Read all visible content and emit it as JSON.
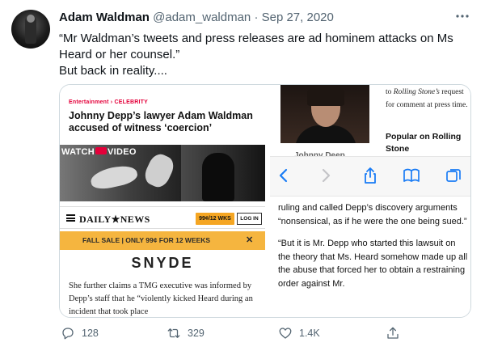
{
  "tweet": {
    "name": "Adam Waldman",
    "handle": "@adam_waldman",
    "separator": "·",
    "date": "Sep 27, 2020",
    "more_icon": "more-icon",
    "text_line1": "“Mr Waldman’s tweets and press releases are ad hominem attacks on Ms Heard or her counsel.”",
    "text_line2": "But back in reality...."
  },
  "left_screenshot": {
    "crumb": "Entertainment › CELEBRITY",
    "headline": "Johnny Depp’s lawyer Adam Waldman accused of witness ‘coercion’",
    "watch_prefix": "WATCH",
    "watch_suffix": "VIDEO",
    "logo": "DAILY★NEWS",
    "price_badge": "99¢/12 WKS",
    "login": "LOG IN",
    "sale_text": "FALL SALE | ONLY 99¢ FOR 12 WEEKS",
    "sale_close": "✕",
    "section": "SNYDE",
    "article": "She further claims a TMG executive was informed by Depp’s staff that he “violently kicked Heard during an incident that took place"
  },
  "right_screenshot": {
    "side_copy_pre": "to ",
    "side_copy_italic": "Rolling Stone’s",
    "side_copy_post": " request for comment at press time.",
    "popular": "Popular on Rolling Stone",
    "cut_name": "Johnny Deep",
    "para1": "ruling and called Depp’s discovery arguments “nonsensical, as if he were the one being sued.”",
    "para2": "“But it is Mr. Depp who started this lawsuit on the theory that Ms. Heard somehow made up all the abuse that forced her to obtain a restraining order against Mr."
  },
  "actions": {
    "replies": "128",
    "retweets": "329",
    "likes": "1.4K"
  },
  "colors": {
    "accent_red": "#e4003a",
    "sale_orange": "#f5b53f",
    "safari_blue": "#1a7cf5",
    "meta_gray": "#536471"
  }
}
